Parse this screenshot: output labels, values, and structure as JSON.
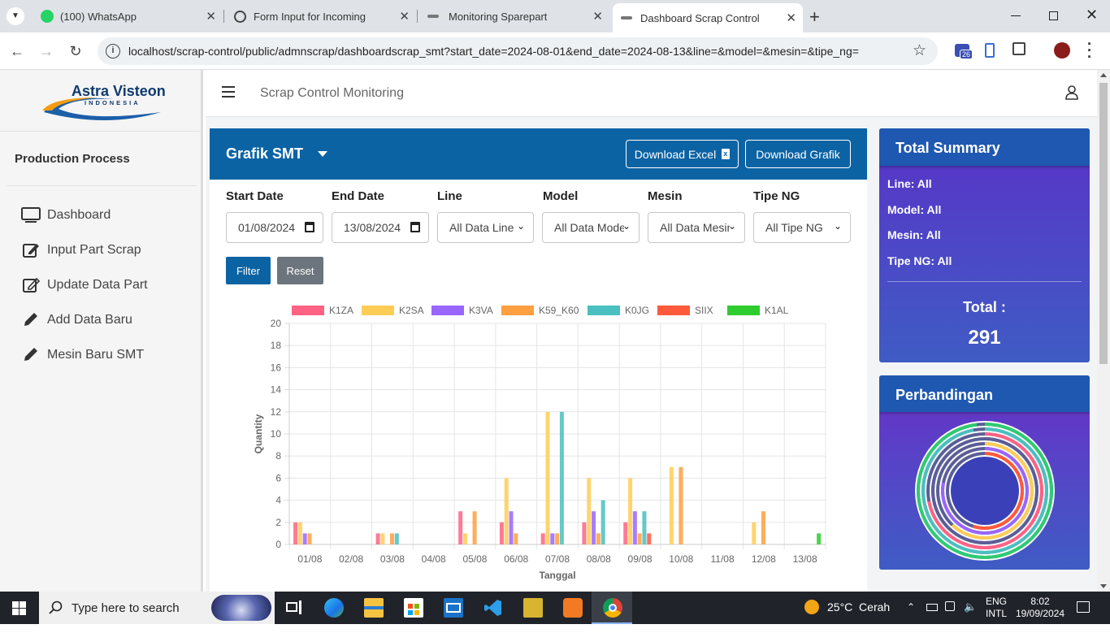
{
  "browser": {
    "tabs": [
      {
        "label": "(100) WhatsApp",
        "icon": "whatsapp-icon"
      },
      {
        "label": "Form Input for Incoming",
        "icon": "openai-icon"
      },
      {
        "label": "Monitoring Sparepart",
        "icon": "page-icon"
      },
      {
        "label": "Dashboard Scrap Control",
        "icon": "page-icon"
      }
    ],
    "url": "localhost/scrap-control/public/admnscrap/dashboardscrap_smt?start_date=2024-08-01&end_date=2024-08-13&line=&model=&mesin=&tipe_ng=",
    "extension_badge": "26"
  },
  "sidebar": {
    "logo_text": "Astra Visteon",
    "logo_sub": "INDONESIA",
    "heading": "Production Process",
    "items": [
      {
        "label": "Dashboard",
        "icon": "monitor-icon"
      },
      {
        "label": "Input Part Scrap",
        "icon": "edit-icon"
      },
      {
        "label": "Update Data Part",
        "icon": "edit-icon"
      },
      {
        "label": "Add Data Baru",
        "icon": "pencil-icon"
      },
      {
        "label": "Mesin Baru SMT",
        "icon": "pencil-icon"
      }
    ]
  },
  "header": {
    "title": "Scrap Control Monitoring"
  },
  "card": {
    "title": "Grafik SMT",
    "download_excel": "Download Excel",
    "download_grafik": "Download Grafik"
  },
  "filters": {
    "start_label": "Start Date",
    "start_value": "01/08/2024",
    "end_label": "End Date",
    "end_value": "13/08/2024",
    "line_label": "Line",
    "line_value": "All Data Line",
    "model_label": "Model",
    "model_value": "All Data Model",
    "mesin_label": "Mesin",
    "mesin_value": "All Data Mesin",
    "tipe_label": "Tipe NG",
    "tipe_value": "All Tipe NG",
    "filter_btn": "Filter",
    "reset_btn": "Reset"
  },
  "chart_data": {
    "type": "bar",
    "categories": [
      "01/08",
      "02/08",
      "03/08",
      "04/08",
      "05/08",
      "06/08",
      "07/08",
      "08/08",
      "09/08",
      "10/08",
      "11/08",
      "12/08",
      "13/08"
    ],
    "xlabel": "Tanggal",
    "ylabel": "Quantity",
    "ylim": [
      0,
      20
    ],
    "yticks": [
      0,
      2,
      4,
      6,
      8,
      10,
      12,
      14,
      16,
      18,
      20
    ],
    "grid": true,
    "legend_position": "top",
    "series": [
      {
        "name": "K1ZA",
        "color": "#ff6384",
        "values": [
          2,
          0,
          1,
          0,
          3,
          2,
          1,
          2,
          2,
          0,
          0,
          0,
          0
        ]
      },
      {
        "name": "K2SA",
        "color": "#ffcd56",
        "values": [
          2,
          0,
          1,
          0,
          1,
          6,
          12,
          6,
          6,
          7,
          0,
          2,
          0
        ]
      },
      {
        "name": "K3VA",
        "color": "#9966ff",
        "values": [
          1,
          0,
          0,
          0,
          0,
          3,
          1,
          3,
          3,
          0,
          0,
          0,
          0
        ]
      },
      {
        "name": "K59_K60",
        "color": "#ff9f40",
        "values": [
          1,
          0,
          1,
          0,
          3,
          1,
          1,
          1,
          1,
          7,
          0,
          3,
          0
        ]
      },
      {
        "name": "K0JG",
        "color": "#4bc0c0",
        "values": [
          0,
          0,
          1,
          0,
          0,
          0,
          12,
          4,
          3,
          0,
          0,
          0,
          0
        ]
      },
      {
        "name": "SIIX",
        "color": "#ff5a3c",
        "values": [
          0,
          0,
          0,
          0,
          0,
          0,
          0,
          0,
          1,
          0,
          0,
          0,
          0
        ]
      },
      {
        "name": "K1AL",
        "color": "#2ecc2e",
        "values": [
          0,
          0,
          0,
          0,
          0,
          0,
          0,
          0,
          0,
          0,
          0,
          0,
          1
        ]
      }
    ]
  },
  "summary": {
    "title": "Total Summary",
    "line": "Line: All",
    "model": "Model: All",
    "mesin": "Mesin: All",
    "tipe_ng": "Tipe NG: All",
    "total_label": "Total :",
    "total_value": "291"
  },
  "comparison": {
    "title": "Perbandingan"
  },
  "taskbar": {
    "search_placeholder": "Type here to search",
    "weather": "25°C  Cerah",
    "lang_1": "ENG",
    "lang_2": "INTL",
    "time": "8:02",
    "date": "19/09/2024"
  }
}
